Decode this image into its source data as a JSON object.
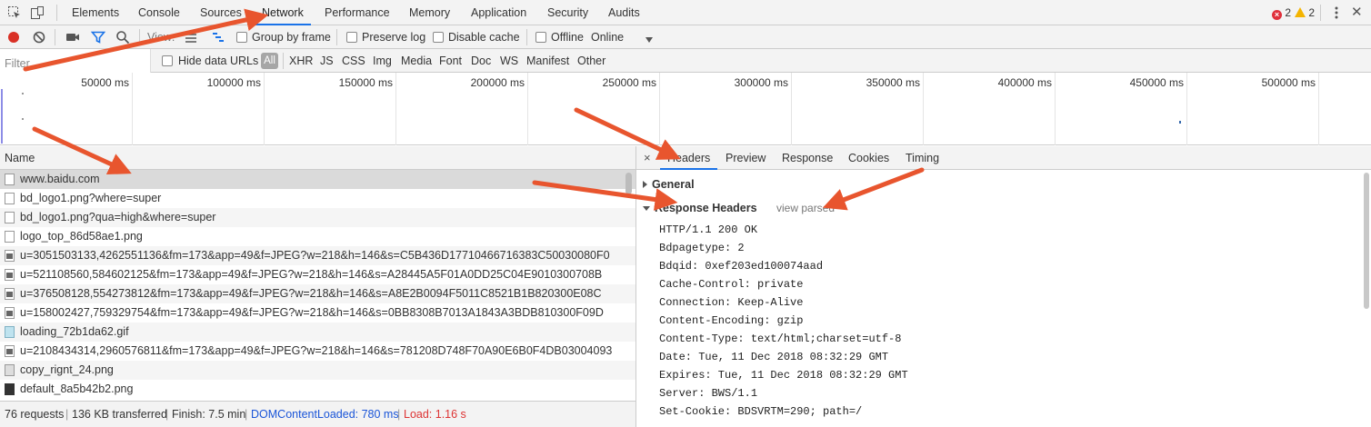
{
  "topbar": {
    "tabs": [
      "Elements",
      "Console",
      "Sources",
      "Network",
      "Performance",
      "Memory",
      "Application",
      "Security",
      "Audits"
    ],
    "active_tab": "Network",
    "error_count": "2",
    "warning_count": "2"
  },
  "toolbar": {
    "view_label": "View:",
    "group_by_frame": "Group by frame",
    "preserve_log": "Preserve log",
    "disable_cache": "Disable cache",
    "offline": "Offline",
    "throttle": "Online"
  },
  "filterbar": {
    "filter_placeholder": "Filter",
    "hide_data_urls": "Hide data URLs",
    "types": [
      "All",
      "XHR",
      "JS",
      "CSS",
      "Img",
      "Media",
      "Font",
      "Doc",
      "WS",
      "Manifest",
      "Other"
    ]
  },
  "overview": {
    "ticks": [
      "50000 ms",
      "100000 ms",
      "150000 ms",
      "200000 ms",
      "250000 ms",
      "300000 ms",
      "350000 ms",
      "400000 ms",
      "450000 ms",
      "500000 ms"
    ]
  },
  "requests": {
    "header": "Name",
    "items": [
      {
        "name": "www.baidu.com",
        "icon": "document-icon"
      },
      {
        "name": "bd_logo1.png?where=super",
        "icon": "document-icon"
      },
      {
        "name": "bd_logo1.png?qua=high&where=super",
        "icon": "document-icon"
      },
      {
        "name": "logo_top_86d58ae1.png",
        "icon": "document-icon"
      },
      {
        "name": "u=3051503133,4262551136&fm=173&app=49&f=JPEG?w=218&h=146&s=C5B436D17710466716383C50030080F0",
        "icon": "image-icon"
      },
      {
        "name": "u=521108560,584602125&fm=173&app=49&f=JPEG?w=218&h=146&s=A28445A5F01A0DD25C04E9010300708B",
        "icon": "image-icon"
      },
      {
        "name": "u=376508128,554273812&fm=173&app=49&f=JPEG?w=218&h=146&s=A8E2B0094F5011C8521B1B820300E08C",
        "icon": "image-icon"
      },
      {
        "name": "u=158002427,759329754&fm=173&app=49&f=JPEG?w=218&h=146&s=0BB8308B7013A1843A3BDB810300F09D",
        "icon": "image-icon"
      },
      {
        "name": "loading_72b1da62.gif",
        "icon": "gif-icon"
      },
      {
        "name": "u=2108434314,2960576811&fm=173&app=49&f=JPEG?w=218&h=146&s=781208D748F70A90E6B0F4DB03004093",
        "icon": "image-icon"
      },
      {
        "name": "copy_rignt_24.png",
        "icon": "image-icon"
      },
      {
        "name": "default_8a5b42b2.png",
        "icon": "dark-image-icon"
      }
    ]
  },
  "statusbar": {
    "requests": "76 requests",
    "transferred": "136 KB transferred",
    "finish": "Finish: 7.5 min",
    "dom_content_loaded": "DOMContentLoaded: 780 ms",
    "load": "Load: 1.16 s",
    "separator": "|"
  },
  "details": {
    "tabs": [
      "Headers",
      "Preview",
      "Response",
      "Cookies",
      "Timing"
    ],
    "active_tab": "Headers",
    "close_glyph": "×",
    "general_label": "General",
    "response_headers_label": "Response Headers",
    "view_parsed": "view parsed",
    "response_headers": [
      "HTTP/1.1 200 OK",
      "Bdpagetype: 2",
      "Bdqid: 0xef203ed100074aad",
      "Cache-Control: private",
      "Connection: Keep-Alive",
      "Content-Encoding: gzip",
      "Content-Type: text/html;charset=utf-8",
      "Date: Tue, 11 Dec 2018 08:32:29 GMT",
      "Expires: Tue, 11 Dec 2018 08:32:29 GMT",
      "Server: BWS/1.1",
      "Set-Cookie: BDSVRTM=290; path=/"
    ]
  },
  "colors": {
    "accent": "#1a73e8",
    "dom_content_loaded": "#1a55d8",
    "load": "#d33",
    "record": "#d93025",
    "annotation_arrow": "#e8552e"
  }
}
